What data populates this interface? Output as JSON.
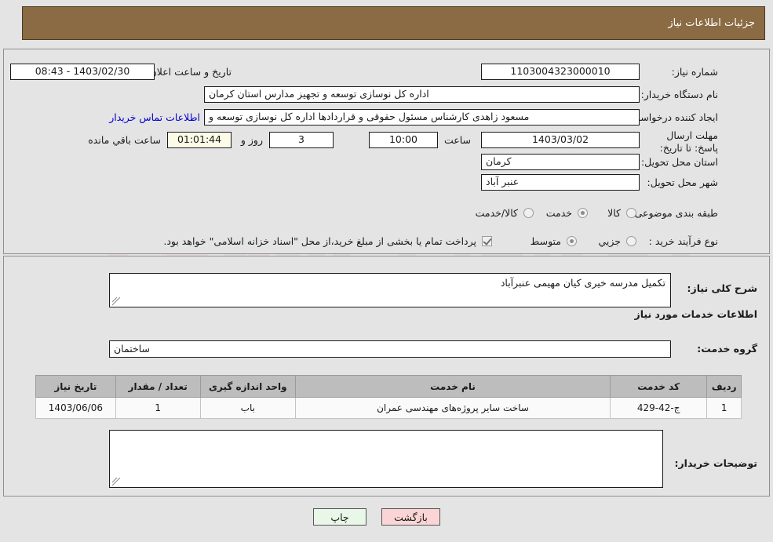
{
  "header": {
    "title": "جزئیات اطلاعات نیاز"
  },
  "colors": {
    "header_bg": "#8b6b43",
    "link": "#0000d0",
    "table_header_bg": "#bdbdbd",
    "print_button_bg": "#e9f7e9",
    "back_button_bg": "#fbd5d5",
    "countdown_bg": "#fbfbe7"
  },
  "watermark": {
    "text": "AriaTender.net"
  },
  "form": {
    "need_number_label": "شماره نیاز:",
    "need_number_value": "1103004323000010",
    "announce_datetime_label": "تاریخ و ساعت اعلان عمومی:",
    "announce_datetime_value": "1403/02/30 - 08:43",
    "buyer_org_label": "نام دستگاه خریدار:",
    "buyer_org_value": "اداره کل نوسازی  توسعه و تجهیز مدارس استان کرمان",
    "creator_label": "ایجاد کننده درخواست:",
    "creator_value": "مسعود زاهدی کارشناس مسئول حقوقی و قراردادها اداره کل نوسازی  توسعه و",
    "contact_link": "اطلاعات تماس خریدار",
    "deadline_label": "مهلت ارسال پاسخ: تا تاریخ:",
    "deadline_date": "1403/03/02",
    "deadline_time_label": "ساعت",
    "deadline_time_value": "10:00",
    "remaining_days_value": "3",
    "remaining_days_label": "روز و",
    "remaining_clock_value": "01:01:44",
    "remaining_suffix_label": "ساعت باقي مانده",
    "province_label": "استان محل تحویل:",
    "province_value": "کرمان",
    "city_label": "شهر محل تحویل:",
    "city_value": "عنبر آباد",
    "category_label": "طبقه بندی موضوعی:",
    "category_options": [
      {
        "label": "کالا",
        "selected": false
      },
      {
        "label": "خدمت",
        "selected": true
      },
      {
        "label": "کالا/خدمت",
        "selected": false
      }
    ],
    "process_label": "نوع فرآیند خرید :",
    "process_options": [
      {
        "label": "جزیي",
        "selected": false
      },
      {
        "label": "متوسط",
        "selected": true
      }
    ],
    "treasury_checkbox_checked": true,
    "treasury_note": "پرداخت تمام یا بخشی از مبلغ خرید،از محل \"اسناد خزانه اسلامی\" خواهد بود."
  },
  "description": {
    "label": "شرح کلی نیاز:",
    "value": "تکمیل مدرسه خیری کیان مهیمی عنبرآباد"
  },
  "services_section": {
    "heading": "اطلاعات خدمات مورد نیاز",
    "group_label": "گروه خدمت:",
    "group_value": "ساختمان"
  },
  "table": {
    "columns": [
      "ردیف",
      "کد خدمت",
      "نام خدمت",
      "واحد اندازه گیری",
      "تعداد / مقدار",
      "تاریخ نیاز"
    ],
    "rows": [
      {
        "row_no": "1",
        "service_code": "ج-42-429",
        "service_name": "ساخت سایر پروژه‌های مهندسی عمران",
        "unit": "باب",
        "quantity": "1",
        "need_date": "1403/06/06"
      }
    ]
  },
  "buyer_comments": {
    "label": "توضیحات خریدار:",
    "value": ""
  },
  "buttons": {
    "print": "چاپ",
    "back": "بازگشت"
  }
}
